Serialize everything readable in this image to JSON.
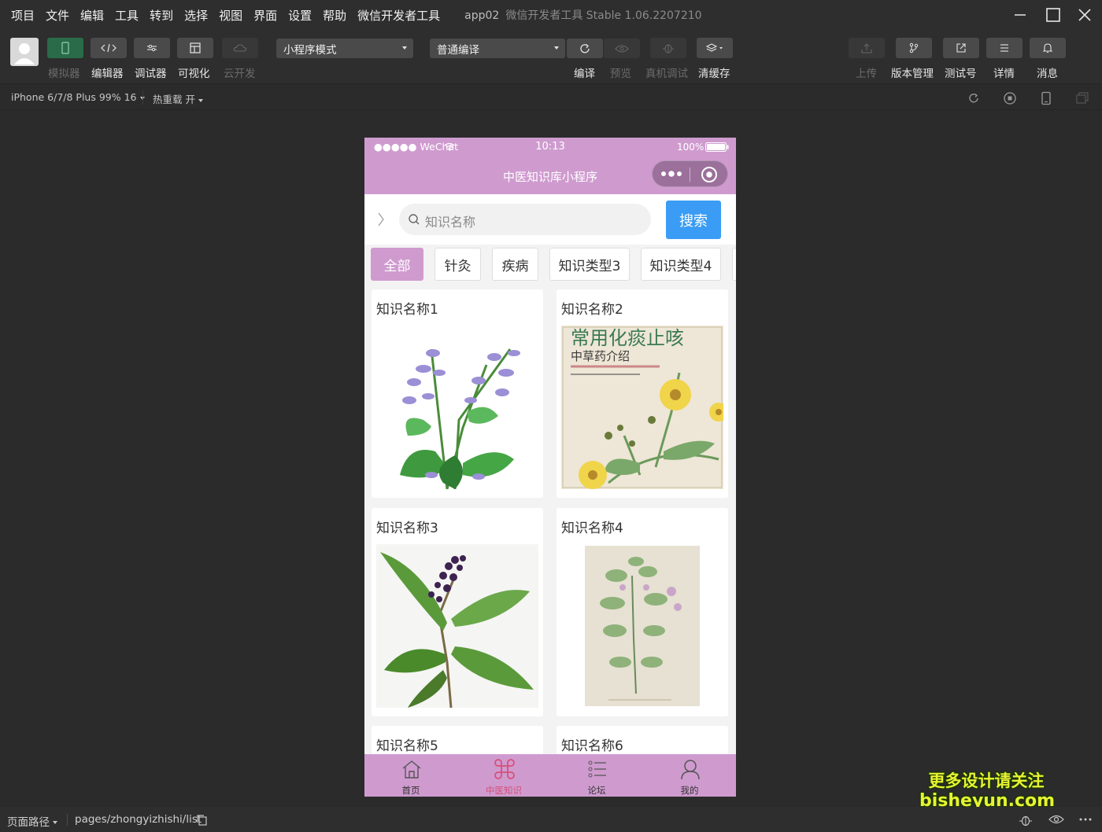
{
  "menu": [
    "项目",
    "文件",
    "编辑",
    "工具",
    "转到",
    "选择",
    "视图",
    "界面",
    "设置",
    "帮助",
    "微信开发者工具"
  ],
  "app_title": {
    "project": "app02",
    "product": "微信开发者工具 Stable 1.06.2207210"
  },
  "toolbar": {
    "simulator": "模拟器",
    "editor": "编辑器",
    "debugger": "调试器",
    "visual": "可视化",
    "cloud": "云开发",
    "mode_select": "小程序模式",
    "compile_select": "普通编译",
    "compile": "编译",
    "preview": "预览",
    "remote_debug": "真机调试",
    "clear_cache": "清缓存",
    "upload": "上传",
    "version": "版本管理",
    "test_account": "测试号",
    "details": "详情",
    "messages": "消息"
  },
  "subbar": {
    "device": "iPhone 6/7/8 Plus 99% 16",
    "hot_reload": "热重载 开"
  },
  "phone": {
    "status": {
      "carrier": "●●●●● WeChat",
      "time": "10:13",
      "battery": "100%"
    },
    "nav_title": "中医知识库小程序",
    "search_placeholder": "知识名称",
    "search_button": "搜索",
    "tabs": [
      "全部",
      "针灸",
      "疾病",
      "知识类型3",
      "知识类型4"
    ],
    "cards": [
      {
        "title": "知识名称1"
      },
      {
        "title": "知识名称2",
        "book_title": "常用化痰止咳",
        "book_subtitle": "中草药介绍"
      },
      {
        "title": "知识名称3"
      },
      {
        "title": "知识名称4"
      },
      {
        "title": "知识名称5"
      },
      {
        "title": "知识名称6"
      }
    ],
    "tabbar": [
      "首页",
      "中医知识",
      "论坛",
      "我的"
    ]
  },
  "footer": {
    "page_path_label": "页面路径",
    "page_path": "pages/zhongyizhishi/list"
  },
  "watermark": {
    "line1": "更多设计请关注",
    "line2": "bisheyun.com"
  },
  "colors": {
    "accent": "#cf9bcf",
    "search_button": "#3a9cf5",
    "active_tab_text": "#d6507a",
    "simulator_active": "#2a6b4a"
  }
}
